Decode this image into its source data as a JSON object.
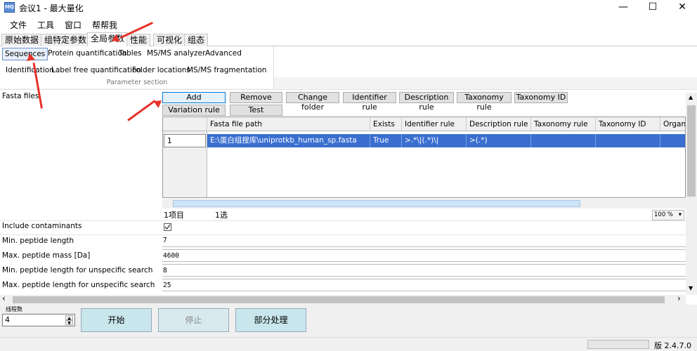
{
  "window": {
    "icon_text": "MQ",
    "title": "会议1 - 最大量化",
    "minimize": "—",
    "maximize": "☐",
    "close": "✕"
  },
  "menu": [
    "文件",
    "工具",
    "窗口",
    "帮帮我"
  ],
  "main_tabs": [
    "原始数据",
    "组特定参数",
    "全局参数",
    "性能",
    "可视化",
    "组态"
  ],
  "main_tabs_active": "全局参数",
  "ribbon": {
    "row1": [
      "Sequences",
      "Protein quantification",
      "Tables",
      "MS/MS analyzer",
      "Advanced"
    ],
    "row2": [
      "Identification",
      "Label free quantification",
      "Folder locations",
      "MS/MS fragmentation"
    ],
    "selected": "Sequences",
    "section_label": "Parameter section"
  },
  "fasta": {
    "label": "Fasta files",
    "buttons_row1": [
      "Add",
      "Remove",
      "Change folder",
      "Identifier rule",
      "Description rule",
      "Taxonomy rule",
      "Taxonomy ID"
    ],
    "buttons_row2": [
      "Variation rule",
      "Test"
    ],
    "columns": [
      "Fasta file path",
      "Exists",
      "Identifier rule",
      "Description rule",
      "Taxonomy rule",
      "Taxonomy ID",
      "Organi"
    ],
    "rows": [
      {
        "num": "1",
        "path": "E:\\蛋白组搜库\\uniprotkb_human_sp.fasta",
        "exists": "True",
        "identifier_rule": ">.*\\|(.*)\\|",
        "description_rule": ">(.*)",
        "taxonomy_rule": "",
        "taxonomy_id": "",
        "organism": ""
      }
    ],
    "items_count": "1项目",
    "selected_count": "1选",
    "zoom": "100 %"
  },
  "params": [
    {
      "label": "Include contaminants",
      "value": "",
      "checkbox": true
    },
    {
      "label": "Min. peptide length",
      "value": "7"
    },
    {
      "label": "Max. peptide mass [Da]",
      "value": "4600"
    },
    {
      "label": "Min. peptide length for unspecific search",
      "value": "8"
    },
    {
      "label": "Max. peptide length for unspecific search",
      "value": "25"
    }
  ],
  "bottom": {
    "threads_label": "线程数",
    "threads_value": "4",
    "start": "开始",
    "stop": "停止",
    "partial": "部分处理"
  },
  "status": {
    "version": "版 2.4.7.0"
  },
  "colors": {
    "selection_blue": "#3a6fd0",
    "arrow_red": "#e8322a",
    "big_button_teal": "#c8e6ec"
  }
}
